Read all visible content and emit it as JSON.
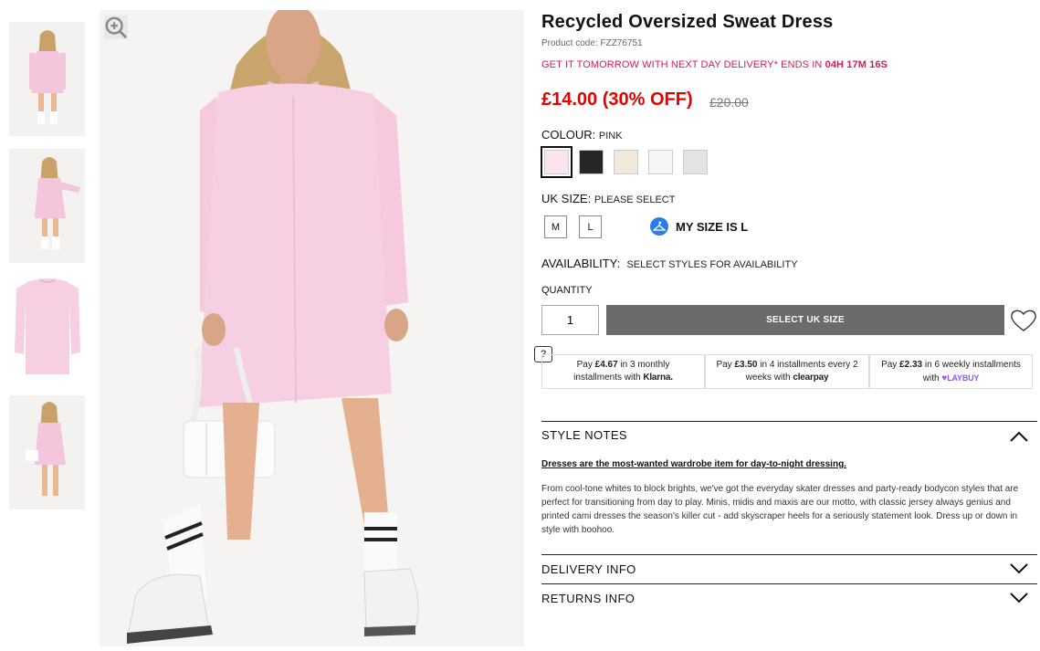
{
  "product": {
    "title": "Recycled Oversized Sweat Dress",
    "product_code": "Product code: FZZ76751",
    "delivery_prefix": "GET IT TOMORROW WITH NEXT DAY DELIVERY* ENDS IN ",
    "delivery_countdown": "04H 17M 16S",
    "price": "£14.00 (30% OFF)",
    "was_price": "£20.00"
  },
  "colour": {
    "label": "COLOUR:",
    "value": "PINK",
    "swatches": [
      {
        "name": "pink",
        "color": "#fbe3ef",
        "selected": true
      },
      {
        "name": "black",
        "color": "#262626",
        "selected": false
      },
      {
        "name": "stone",
        "color": "#f2e8da",
        "selected": false
      },
      {
        "name": "white",
        "color": "#f6f6f6",
        "selected": false
      },
      {
        "name": "grey",
        "color": "#e3e3e5",
        "selected": false
      }
    ]
  },
  "size": {
    "label": "UK SIZE:",
    "value": "PLEASE SELECT",
    "options": [
      "M",
      "L"
    ],
    "my_size": "MY SIZE IS L"
  },
  "availability": {
    "label": "AVAILABILITY:",
    "value": "SELECT STYLES FOR AVAILABILITY"
  },
  "quantity": {
    "label": "QUANTITY",
    "value": "1"
  },
  "add_button": "SELECT UK SIZE",
  "help_mark": "?",
  "payments": [
    {
      "pre": "Pay ",
      "amount": "£4.67",
      "mid": " in 3 monthly",
      "line2": "installments with ",
      "brand": "Klarna."
    },
    {
      "pre": "Pay ",
      "amount": "£3.50",
      "mid": " in 4 installments every 2",
      "line2": "weeks with ",
      "brand": "clearpay"
    },
    {
      "pre": "Pay ",
      "amount": "£2.33",
      "mid": " in 6 weekly installments",
      "line2": "with ",
      "brand": "LAYBUY"
    }
  ],
  "style_notes": {
    "title": "STYLE NOTES",
    "headline": "Dresses are the most-wanted wardrobe item for day-to-night dressing.",
    "body": "From cool-tone whites to block brights, we've got the everyday skater dresses and party-ready bodycon styles that are perfect for transitioning from day to play. Minis, midis and maxis are our motto, with classic jersey always genius and printed cami dresses the season's killer cut - add skyscraper heels for a seriously statement look. Dress up or down in style with boohoo."
  },
  "delivery_info": "DELIVERY INFO",
  "returns_info": "RETURNS INFO",
  "icons": {
    "zoom": "zoom-icon",
    "heart": "heart-icon",
    "hanger": "hanger-icon",
    "chevron_up": "chevron-up-icon",
    "chevron_down": "chevron-down-icon"
  },
  "colors": {
    "accent_pink": "#d6195c",
    "price_red": "#e60000",
    "button_grey": "#6b6b6b",
    "dress_pink": "#f7cfe2"
  }
}
